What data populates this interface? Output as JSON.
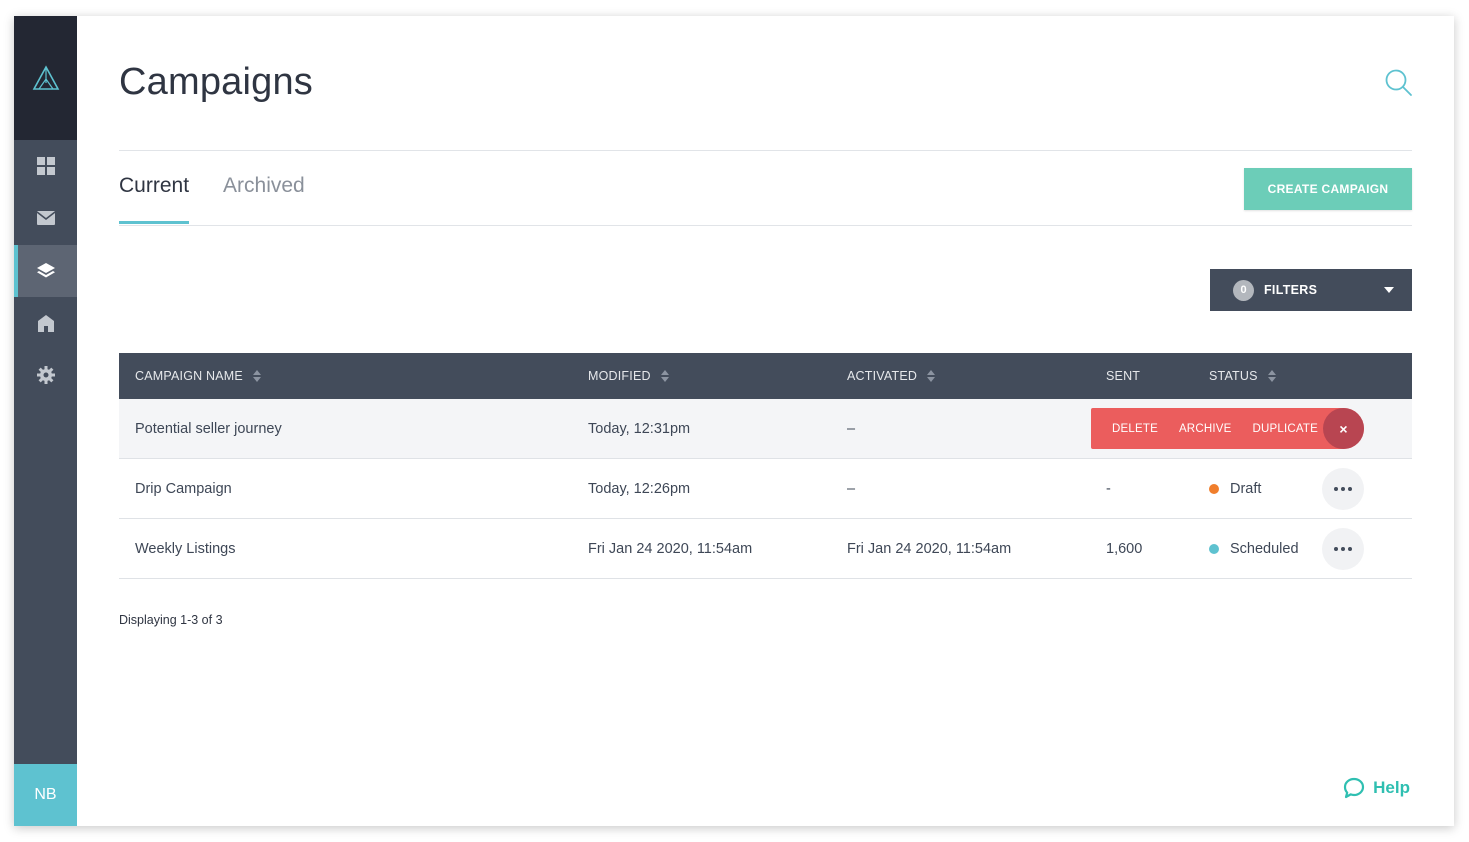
{
  "colors": {
    "sidebar_bg": "#434c5b",
    "sidebar_dark": "#232733",
    "accent_teal": "#5ec2d0",
    "create_button": "#6ccdb8",
    "danger": "#eb5d5d",
    "draft_status": "#f07e2c",
    "scheduled_status": "#5ec2d0",
    "help": "#2fbfb1"
  },
  "sidebar": {
    "logo_icon": "triangle-logo-icon",
    "items": [
      {
        "icon": "dashboard-grid-icon",
        "active": false
      },
      {
        "icon": "envelope-icon",
        "active": false
      },
      {
        "icon": "layers-icon",
        "active": true
      },
      {
        "icon": "home-icon",
        "active": false
      },
      {
        "icon": "gear-icon",
        "active": false
      }
    ],
    "avatar_initials": "NB"
  },
  "header": {
    "title": "Campaigns",
    "search_icon": "search-icon"
  },
  "tabs": [
    {
      "label": "Current",
      "active": true
    },
    {
      "label": "Archived",
      "active": false
    }
  ],
  "create_button_label": "CREATE CAMPAIGN",
  "filters": {
    "count": "0",
    "label": "FILTERS"
  },
  "table": {
    "columns": [
      "CAMPAIGN NAME",
      "MODIFIED",
      "ACTIVATED",
      "SENT",
      "STATUS"
    ],
    "rows": [
      {
        "name": "Potential seller journey",
        "modified": "Today, 12:31pm",
        "activated": "–",
        "sent": "",
        "status": ""
      },
      {
        "name": "Drip Campaign",
        "modified": "Today, 12:26pm",
        "activated": "–",
        "sent": "-",
        "status": "Draft"
      },
      {
        "name": "Weekly Listings",
        "modified": "Fri Jan 24 2020, 11:54am",
        "activated": "Fri Jan 24 2020, 11:54am",
        "sent": "1,600",
        "status": "Scheduled"
      }
    ]
  },
  "row_actions": {
    "delete": "DELETE",
    "archive": "ARCHIVE",
    "duplicate": "DUPLICATE",
    "close": "×"
  },
  "pagination_text": "Displaying 1-3 of 3",
  "help_label": "Help"
}
